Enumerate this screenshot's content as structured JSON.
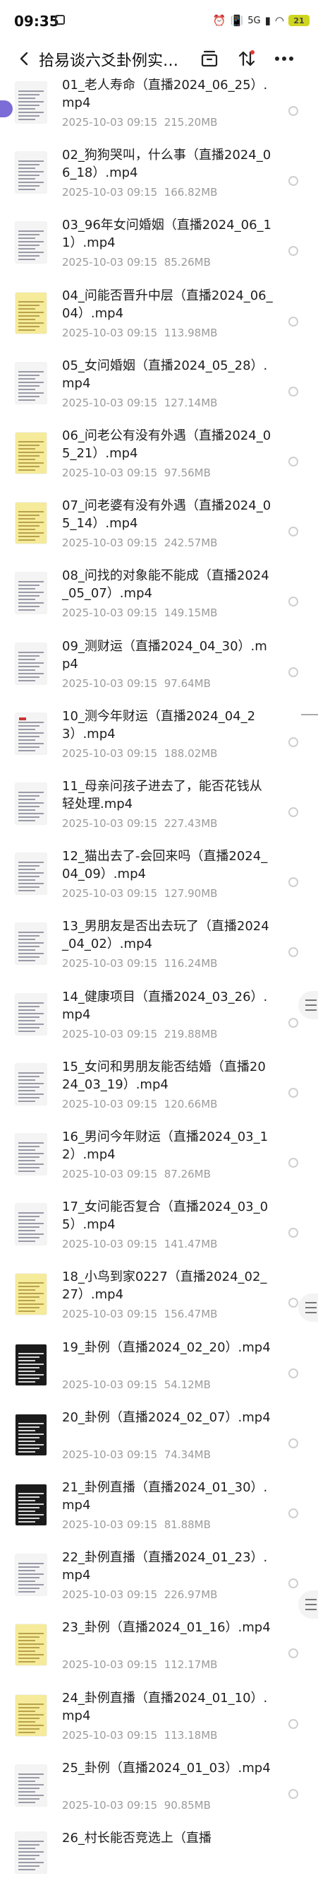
{
  "status_bar": {
    "time": "09:35",
    "network": "5G",
    "battery": "21"
  },
  "header": {
    "title": "拾易谈六爻卦例实…"
  },
  "icons": [
    "back-icon",
    "save-to-cloud-icon",
    "sort-icon",
    "more-icon"
  ],
  "files": [
    {
      "name": "01_老人寿命（直播2024_06_25）.mp4",
      "date": "2025-10-03  09:15",
      "size": "215.20MB",
      "thumb": "paper"
    },
    {
      "name": "02_狗狗哭叫，什么事（直播2024_06_18）.mp4",
      "date": "2025-10-03  09:15",
      "size": "166.82MB",
      "thumb": "paper"
    },
    {
      "name": "03_96年女问婚姻（直播2024_06_11）.mp4",
      "date": "2025-10-03  09:15",
      "size": "85.26MB",
      "thumb": "paper"
    },
    {
      "name": "04_问能否晋升中层（直播2024_06_04）.mp4",
      "date": "2025-10-03  09:15",
      "size": "113.98MB",
      "thumb": "yellow"
    },
    {
      "name": "05_女问婚姻（直播2024_05_28）.mp4",
      "date": "2025-10-03  09:15",
      "size": "127.14MB",
      "thumb": "paper"
    },
    {
      "name": "06_问老公有没有外遇（直播2024_05_21）.mp4",
      "date": "2025-10-03  09:15",
      "size": "97.56MB",
      "thumb": "yellow"
    },
    {
      "name": "07_问老婆有没有外遇（直播2024_05_14）.mp4",
      "date": "2025-10-03  09:15",
      "size": "242.57MB",
      "thumb": "yellow"
    },
    {
      "name": "08_问找的对象能不能成（直播2024_05_07）.mp4",
      "date": "2025-10-03  09:15",
      "size": "149.15MB",
      "thumb": "paper"
    },
    {
      "name": "09_测财运（直播2024_04_30）.mp4",
      "date": "2025-10-03  09:15",
      "size": "97.64MB",
      "thumb": "paper"
    },
    {
      "name": "10_测今年财运（直播2024_04_23）.mp4",
      "date": "2025-10-03  09:15",
      "size": "188.02MB",
      "thumb": "paper-red"
    },
    {
      "name": "11_母亲问孩子进去了，能否花钱从轻处理.mp4",
      "date": "2025-10-03  09:15",
      "size": "227.43MB",
      "thumb": "paper"
    },
    {
      "name": "12_猫出去了-会回来吗（直播2024_04_09）.mp4",
      "date": "2025-10-03  09:15",
      "size": "127.90MB",
      "thumb": "paper"
    },
    {
      "name": "13_男朋友是否出去玩了（直播2024_04_02）.mp4",
      "date": "2025-10-03  09:15",
      "size": "116.24MB",
      "thumb": "paper"
    },
    {
      "name": "14_健康项目（直播2024_03_26）.mp4",
      "date": "2025-10-03  09:15",
      "size": "219.88MB",
      "thumb": "paper"
    },
    {
      "name": "15_女问和男朋友能否结婚（直播2024_03_19）.mp4",
      "date": "2025-10-03  09:15",
      "size": "120.66MB",
      "thumb": "paper"
    },
    {
      "name": "16_男问今年财运（直播2024_03_12）.mp4",
      "date": "2025-10-03  09:15",
      "size": "87.26MB",
      "thumb": "paper"
    },
    {
      "name": "17_女问能否复合（直播2024_03_05）.mp4",
      "date": "2025-10-03  09:15",
      "size": "141.47MB",
      "thumb": "paper"
    },
    {
      "name": "18_小鸟到家0227（直播2024_02_27）.mp4",
      "date": "2025-10-03  09:15",
      "size": "156.47MB",
      "thumb": "yellow"
    },
    {
      "name": "19_卦例（直播2024_02_20）.mp4",
      "date": "2025-10-03  09:15",
      "size": "54.12MB",
      "thumb": "dark"
    },
    {
      "name": "20_卦例（直播2024_02_07）.mp4",
      "date": "2025-10-03  09:15",
      "size": "74.34MB",
      "thumb": "dark"
    },
    {
      "name": "21_卦例直播（直播2024_01_30）.mp4",
      "date": "2025-10-03  09:15",
      "size": "81.88MB",
      "thumb": "dark"
    },
    {
      "name": "22_卦例直播（直播2024_01_23）.mp4",
      "date": "2025-10-03  09:15",
      "size": "226.97MB",
      "thumb": "paper"
    },
    {
      "name": "23_卦例（直播2024_01_16）.mp4",
      "date": "2025-10-03  09:15",
      "size": "112.17MB",
      "thumb": "yellow"
    },
    {
      "name": "24_卦例直播（直播2024_01_10）.mp4",
      "date": "2025-10-03  09:15",
      "size": "113.18MB",
      "thumb": "yellow"
    },
    {
      "name": "25_卦例（直播2024_01_03）.mp4",
      "date": "2025-10-03  09:15",
      "size": "90.85MB",
      "thumb": "paper"
    },
    {
      "name": "26_村长能否竞选上（直播",
      "date": "",
      "size": "",
      "thumb": "paper"
    }
  ]
}
